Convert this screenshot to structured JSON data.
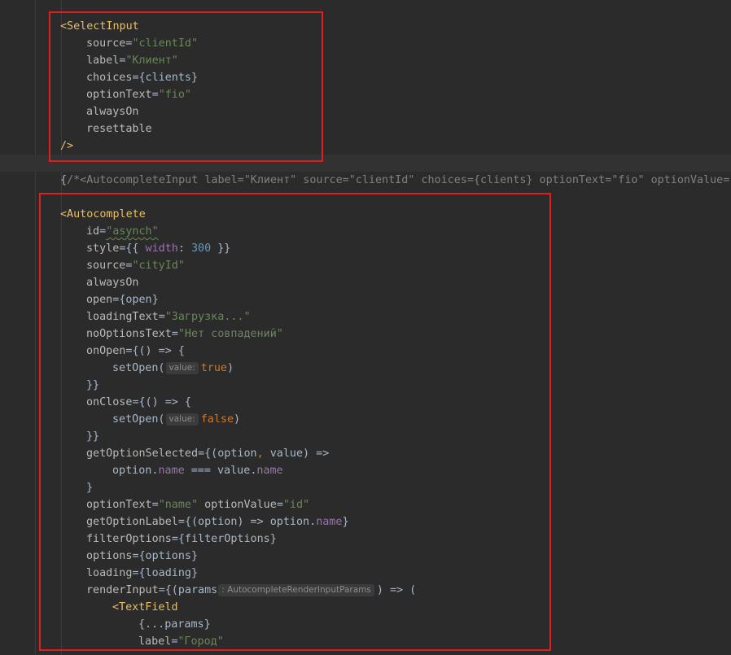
{
  "select_input": {
    "open_tag": "<SelectInput",
    "attrs": [
      {
        "name": "source",
        "value": "\"clientId\""
      },
      {
        "name": "label",
        "value": "\"Клиент\""
      },
      {
        "name": "choices",
        "value": "{clients}"
      },
      {
        "name": "optionText",
        "value": "\"fio\""
      },
      {
        "name": "alwaysOn"
      },
      {
        "name": "resettable"
      }
    ],
    "close_tag": "/>"
  },
  "comment_line": {
    "open": "{",
    "text": "/*<AutocompleteInput label=\"Клиент\" source=\"clientId\" choices={clients} optionText=\"fio\" optionValue=\""
  },
  "autocomplete": {
    "open_tag": "<Autocomplete",
    "id_attr": "id",
    "id_value": "\"asynch\"",
    "style_attr": "style",
    "style_open": "{{ ",
    "style_key": "width",
    "style_colon": ": ",
    "style_num": "300",
    "style_close": " }}",
    "source_attr": "source",
    "source_value": "\"cityId\"",
    "always_on": "alwaysOn",
    "open_attr": "open",
    "open_value": "{open}",
    "loading_text_attr": "loadingText",
    "loading_text_value": "\"Загрузка...\"",
    "no_options_attr": "noOptionsText",
    "no_options_value": "\"Нет совпадений\"",
    "on_open_attr": "onOpen",
    "arrow_open": "{() => {",
    "set_open_call": "setOpen(",
    "hint_value": "value:",
    "true_kw": "true",
    "false_kw": "false",
    "close_paren": ")",
    "close_braces": "}}",
    "on_close_attr": "onClose",
    "get_option_selected_attr": "getOptionSelected",
    "gos_open": "{(option",
    "comma": ",",
    "gos_value": " value) =>",
    "option_word": "option",
    "dot": ".",
    "name_prop": "name",
    "equals": " === ",
    "value_word": "value",
    "close_brace": "}",
    "option_text_attr": "optionText",
    "option_text_value": "\"name\"",
    "option_value_attr": "optionValue",
    "option_value_value": "\"id\"",
    "get_option_label_attr": "getOptionLabel",
    "gol_open": "{(option) => option",
    "gol_close": "}",
    "filter_options_attr": "filterOptions",
    "filter_options_value": "{filterOptions}",
    "options_attr": "options",
    "options_value": "{options}",
    "loading_attr": "loading",
    "loading_value": "{loading}",
    "render_input_attr": "renderInput",
    "render_input_open": "{(params",
    "render_input_hint": ": AutocompleteRenderInputParams",
    "render_input_close": ") => (",
    "text_field_tag": "<TextField",
    "spread_params": "{...params}",
    "tf_label_attr": "label",
    "tf_label_value": "\"Город\""
  },
  "equals_sign": "=",
  "colors": {
    "background": "#2b2b2b",
    "tag": "#e8bf6a",
    "string": "#6a8759",
    "keyword": "#cc7832",
    "property": "#9876aa",
    "number": "#6897bb",
    "comment": "#808080",
    "highlight_box": "#e11d1d"
  }
}
